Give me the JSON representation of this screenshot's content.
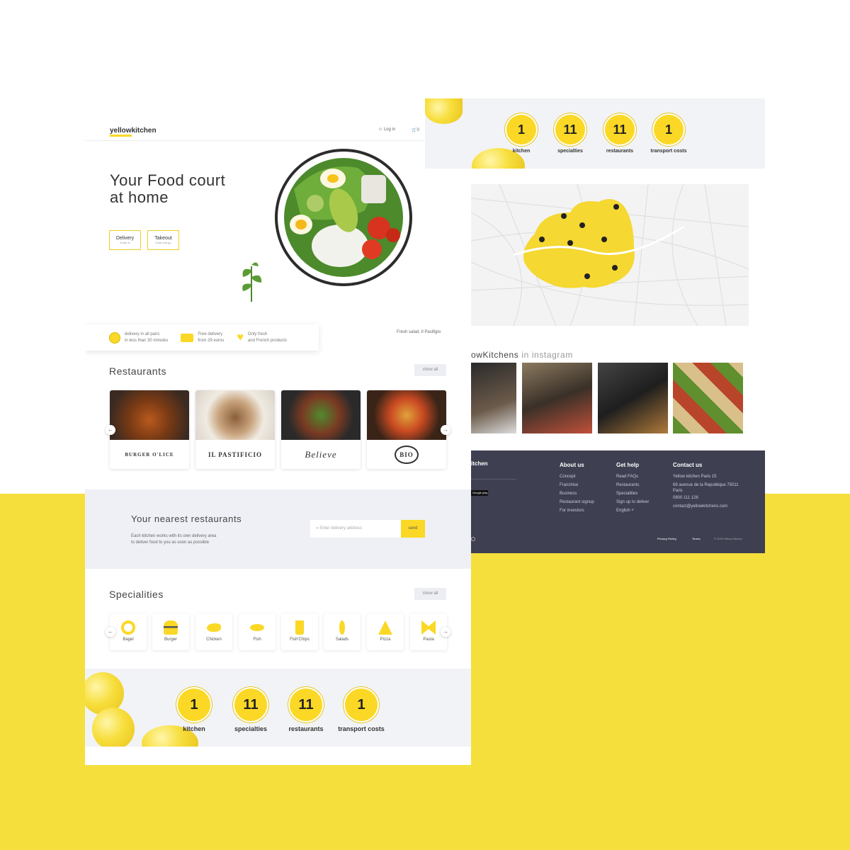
{
  "brand": {
    "name_a": "yellow",
    "name_b": "kitchen"
  },
  "header": {
    "login": "Log in",
    "cart_count": "0"
  },
  "hero": {
    "title_l1": "Your Food court",
    "title_l2": "at home",
    "buttons": [
      {
        "label": "Delivery",
        "sub": "Order in"
      },
      {
        "label": "Takeout",
        "sub": "Grab and go"
      }
    ],
    "caption": "Fresh salad, Il Pasifigio"
  },
  "features": [
    {
      "l1": "delivery in all paris",
      "l2": "in less than 30 minutes",
      "icon": "clock-icon"
    },
    {
      "l1": "Free delivery",
      "l2": "from 29 euros",
      "icon": "truck-icon"
    },
    {
      "l1": "Only fresh",
      "l2": "and French products",
      "icon": "heart-icon"
    }
  ],
  "restaurants": {
    "title": "Restaurants",
    "show_all": "show all",
    "items": [
      {
        "logo": "BURGER O'LICE"
      },
      {
        "logo": "IL PASTIFICIO"
      },
      {
        "logo": "Believe"
      },
      {
        "logo": "BIO"
      }
    ]
  },
  "nearest": {
    "title": "Your nearest restaurants",
    "desc_l1": "Each kitchen works with its own delivery area",
    "desc_l2": "to deliver food to you as soon as possible",
    "placeholder": "Enter delivery address",
    "send": "send"
  },
  "specialities": {
    "title": "Specialities",
    "show_all": "show all",
    "items": [
      "Bagel",
      "Burger",
      "Chicken",
      "Fish",
      "Fish'Chips",
      "Salads",
      "Pizza",
      "Pasta"
    ]
  },
  "stats": [
    {
      "value": "1",
      "label": "kitchen"
    },
    {
      "value": "11",
      "label": "specialties"
    },
    {
      "value": "11",
      "label": "restaurants"
    },
    {
      "value": "1",
      "label": "transport costs"
    }
  ],
  "instagram": {
    "title_a": "owKitchens",
    "title_b": "in instagram"
  },
  "footer": {
    "brand": "itchen",
    "store": "Google play",
    "cols": [
      {
        "title": "About us",
        "links": [
          "Concept",
          "Franchise",
          "Business",
          "Restaurant signup",
          "For investors"
        ]
      },
      {
        "title": "Get help",
        "links": [
          "Read FAQs",
          "Restaurants",
          "Specialities",
          "Sign up to deliver",
          "English"
        ]
      },
      {
        "title": "Contact us",
        "links": [
          "Yellow kitchen Paris 15",
          "69 avenue de la Republique 75011",
          "Paris",
          "0800 111 126",
          "contact@yellowkitchens.com"
        ]
      }
    ],
    "bottom": [
      "Privacy Policy",
      "Terms",
      "© 2020 Yellow Kitchen"
    ]
  },
  "colors": {
    "accent": "#fbd825",
    "background_yellow": "#f5df3d",
    "footer": "#3e3f51"
  }
}
